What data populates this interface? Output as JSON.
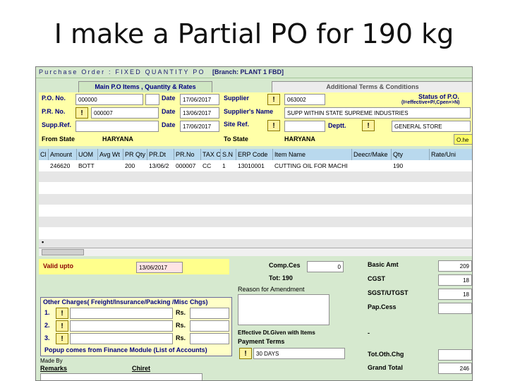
{
  "slide": {
    "title": "I make a Partial PO for 190 kg"
  },
  "window": {
    "title": "Purchase Order : FIXED QUANTITY PO",
    "branch": "[Branch: PLANT 1 FBD]"
  },
  "tabs": [
    {
      "label": "Main P.O Items , Quantity & Rates",
      "active": true
    },
    {
      "label": "Additional Terms & Conditions",
      "active": false
    }
  ],
  "header": {
    "po_no_label": "P.O. No.",
    "po_no_value": "000000",
    "date_label": "Date",
    "po_date": "17/06/2017",
    "pr_no_label": "P.R. No.",
    "pr_no_value": "000007",
    "pr_date": "13/06/2017",
    "supp_ref_label": "Supp.Ref.",
    "supp_ref_value": "",
    "supp_date": "17/06/2017",
    "supplier_label": "Supplier",
    "supplier_code": "063002",
    "supplier_name_label": "Supplier's Name",
    "supplier_name": "SUPP WITHIN STATE SUPREME INDUSTRIES",
    "site_ref_label": "Site Ref.",
    "deptt_label": "Deptt.",
    "dept_value": "GENERAL STORE",
    "status_label": "Status of P.O.",
    "status_hint": "(I=effective+P/,Cpen+>N)",
    "from_state_label": "From State",
    "from_state": "HARYANA",
    "to_state_label": "To State",
    "to_state": "HARYANA",
    "other_btn": "O.he"
  },
  "grid": {
    "columns": [
      "Cl",
      "Amount",
      "UOM",
      "Avg Wt",
      "PR Qty",
      "PR.Dt",
      "PR.No",
      "TAX C",
      "S.N",
      "ERP Code",
      "Item Name",
      "Deecr/Make",
      "Qty",
      "Rate/Uni"
    ],
    "rows": [
      [
        "",
        "246620",
        "BOTT",
        "",
        "200",
        "13/06/2",
        "000007",
        "CC",
        "1",
        "13010001",
        "CUTTING OIL FOR MACHI",
        "",
        "190",
        ""
      ]
    ],
    "row_marker": "•"
  },
  "bottom": {
    "valid_upto_label": "Valid upto",
    "valid_upto": "13/06/2017",
    "comp_ces_label": "Comp.Ces",
    "comp_ces_value": "0",
    "tot_label": "Tot: 190",
    "reason_label": "Reason for Amendment",
    "other_charges_label": "Other Charges( Freight/Insurance/Packing /Misc Chgs)",
    "charge_rows": [
      {
        "num": "1.",
        "rs": "Rs."
      },
      {
        "num": "2.",
        "rs": "Rs."
      },
      {
        "num": "3.",
        "rs": "Rs."
      }
    ],
    "popup_note": "Popup comes from Finance Module (List of Accounts)",
    "effective_label": "Effective Dt.Given with Items",
    "effective_value": "-",
    "payment_terms_label": "Payment Terms",
    "payment_terms": "30 DAYS",
    "made_by_label": "Made By",
    "remarks_label": "Remarks",
    "chiret_label": "Chiret",
    "basic_amt_label": "Basic Amt",
    "basic_amt": "209",
    "cgst_label": "CGST",
    "cgst": "18",
    "sgst_label": "SGST/UTGST",
    "sgst": "18",
    "pap_cess_label": "Pap.Cess",
    "pap_cess": "",
    "tot_oth_label": "Tot.Oth.Chg",
    "tot_oth": "",
    "grand_total_label": "Grand Total",
    "grand_total": "246"
  },
  "colors": {
    "panel_green": "#d6e9cf",
    "header_yellow": "#ffffa8",
    "grid_head_blue": "#b9d9ee",
    "label_navy": "#000080",
    "valid_upto_pink": "#ffe4e4"
  },
  "icons": [
    "exclamation-icon"
  ]
}
